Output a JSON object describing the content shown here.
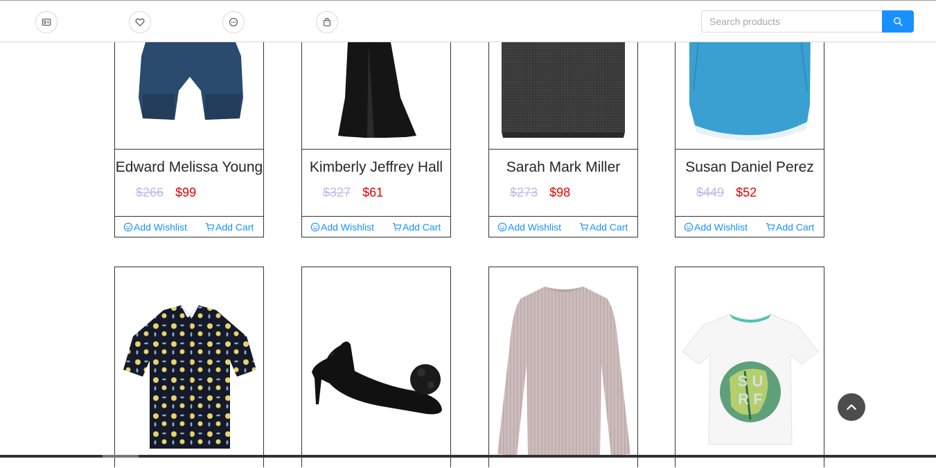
{
  "search": {
    "placeholder": "Search products"
  },
  "nav": {
    "icons": [
      "profile-card-icon",
      "heart-icon",
      "chat-icon",
      "shopping-bag-icon"
    ]
  },
  "colors": {
    "accent": "#1890ff",
    "sale_price": "#e60000",
    "old_price": "#c0b7e8"
  },
  "labels": {
    "add_wishlist": "Add Wishlist",
    "add_cart": "Add Cart"
  },
  "products_row1": [
    {
      "name": "Edward Melissa Young",
      "old_price": "$266",
      "price": "$99"
    },
    {
      "name": "Kimberly Jeffrey Hall",
      "old_price": "$327",
      "price": "$61"
    },
    {
      "name": "Sarah Mark Miller",
      "old_price": "$273",
      "price": "$98"
    },
    {
      "name": "Susan Daniel Perez",
      "old_price": "$449",
      "price": "$52"
    }
  ],
  "products_row2": [
    {
      "image": "floral-shirt"
    },
    {
      "image": "black-pompom-heel"
    },
    {
      "image": "pink-ribbed-sweater"
    },
    {
      "image": "surf-tshirt"
    }
  ]
}
